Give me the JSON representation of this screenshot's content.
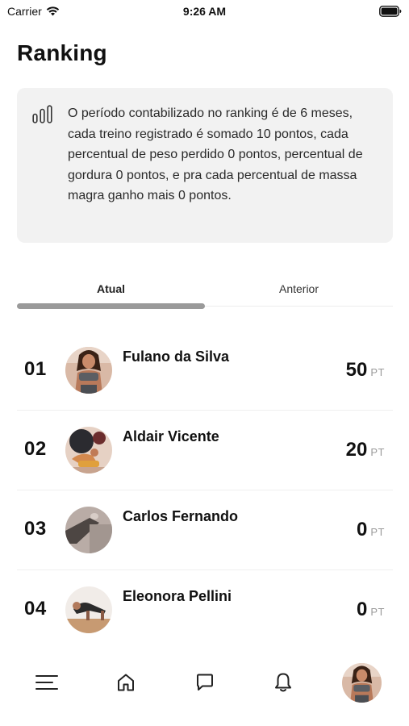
{
  "status_bar": {
    "carrier": "Carrier",
    "time": "9:26 AM"
  },
  "page": {
    "title": "Ranking"
  },
  "info": {
    "text": "O período contabilizado no ranking é de 6 meses, cada treino registrado é somado 10 pontos, cada percentual de peso perdido 0 pontos, percentual de gordura 0 pontos, e pra cada percentual de massa magra ganho mais 0 pontos.",
    "icon": "bar-chart-icon"
  },
  "tabs": [
    {
      "label": "Atual",
      "active": true
    },
    {
      "label": "Anterior",
      "active": false
    }
  ],
  "ranking": [
    {
      "position": "01",
      "name": "Fulano da Silva",
      "points": "50",
      "unit": "PT"
    },
    {
      "position": "02",
      "name": "Aldair Vicente",
      "points": "20",
      "unit": "PT"
    },
    {
      "position": "03",
      "name": "Carlos Fernando",
      "points": "0",
      "unit": "PT"
    },
    {
      "position": "04",
      "name": "Eleonora Pellini",
      "points": "0",
      "unit": "PT"
    }
  ],
  "bottom_nav": {
    "items": [
      "menu-icon",
      "home-icon",
      "chat-icon",
      "bell-icon",
      "profile-avatar"
    ]
  },
  "colors": {
    "info_bg": "#f2f2f2",
    "tab_indicator": "#9a9a9a",
    "unit_text": "#9b9b9b"
  }
}
